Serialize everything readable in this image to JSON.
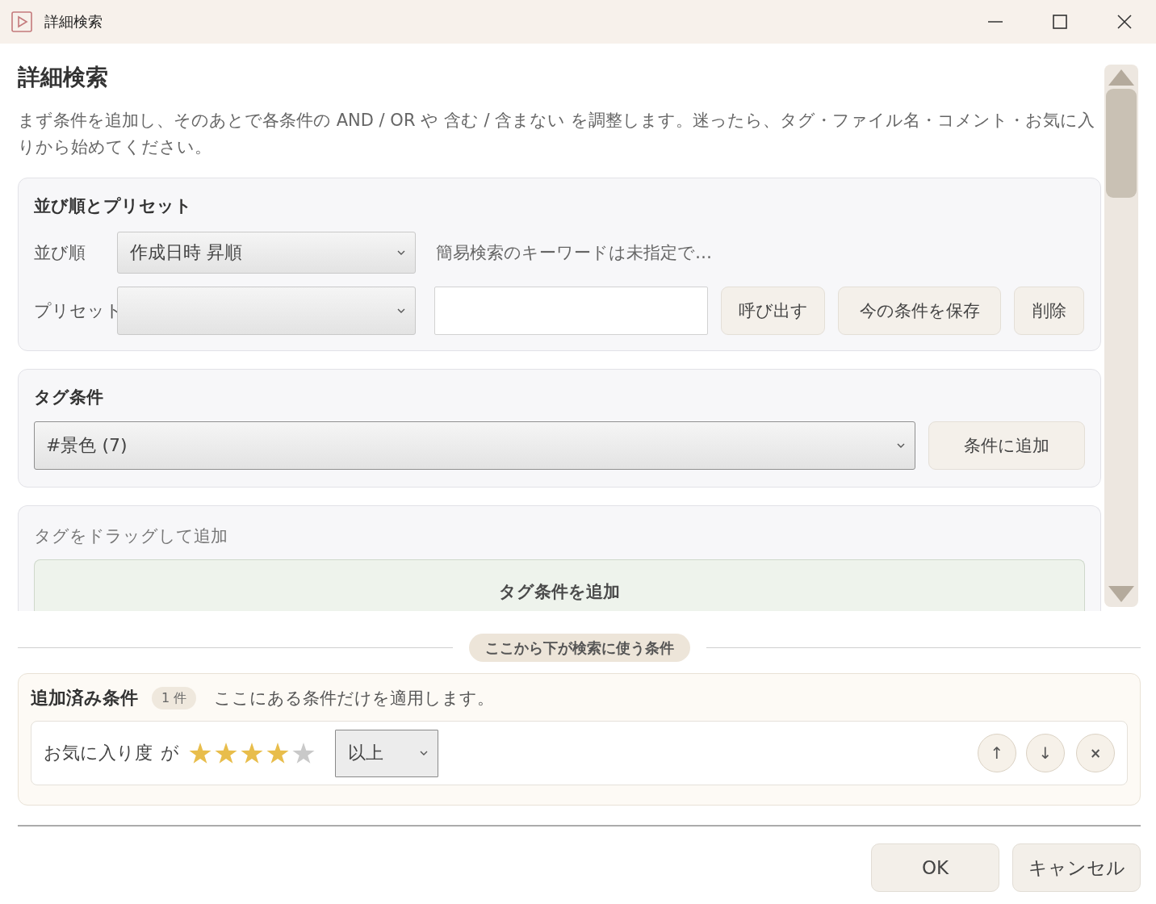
{
  "window": {
    "title": "詳細検索"
  },
  "header": {
    "title": "詳細検索",
    "description": "まず条件を追加し、そのあとで各条件の AND / OR や 含む / 含まない を調整します。迷ったら、タグ・ファイル名・コメント・お気に入りから始めてください。"
  },
  "sort_and_preset": {
    "title": "並び順とプリセット",
    "sort": {
      "label": "並び順",
      "value": "作成日時 昇順",
      "hint": "簡易検索のキーワードは未指定で…"
    },
    "preset": {
      "label": "プリセット",
      "buttons": [
        "呼び出す",
        "今の条件を保存",
        "削除"
      ]
    }
  },
  "tag_condition": {
    "title": "タグ条件",
    "value": "#景色 (7)",
    "button": "条件に追加"
  },
  "tag_drag": {
    "title": "タグをドラッグして追加",
    "drop_label": "タグ条件を追加"
  },
  "divider_label": "ここから下が検索に使う条件",
  "added_conditions": {
    "title": "追加済み条件",
    "count": "1 件",
    "note": "ここにある条件だけを適用します。",
    "items": [
      {
        "kind": "rating",
        "field": "お気に入り度",
        "particle": "が",
        "stars": 4,
        "operator": "以上",
        "actions": [
          "↑",
          "↓",
          "×"
        ]
      }
    ]
  },
  "buttons": [
    "OK",
    "キャンセル"
  ]
}
